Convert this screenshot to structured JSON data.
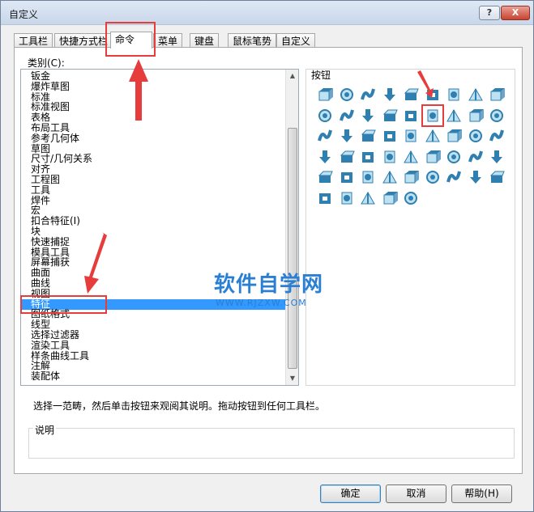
{
  "window": {
    "title": "自定义",
    "help_label": "?",
    "close_label": "X"
  },
  "tabs": [
    {
      "label": "工具栏"
    },
    {
      "label": "快捷方式栏"
    },
    {
      "label": "命令"
    },
    {
      "label": "菜单"
    },
    {
      "label": "键盘"
    },
    {
      "label": "鼠标笔势"
    },
    {
      "label": "自定义"
    }
  ],
  "categories": {
    "label": "类别(C):",
    "items": [
      "钣金",
      "爆炸草图",
      "标准",
      "标准视图",
      "表格",
      "布局工具",
      "参考几何体",
      "草图",
      "尺寸/几何关系",
      "对齐",
      "工程图",
      "工具",
      "焊件",
      "宏",
      "扣合特征(I)",
      "块",
      "快速捕捉",
      "模具工具",
      "屏幕捕获",
      "曲面",
      "曲线",
      "视图",
      "特征",
      "图纸格式",
      "线型",
      "选择过滤器",
      "渲染工具",
      "样条曲线工具",
      "注解",
      "装配体"
    ],
    "selected": "特征"
  },
  "buttons_group": {
    "label": "按钮",
    "icons": [
      "extruded-boss-icon",
      "revolved-boss-icon",
      "swept-boss-icon",
      "lofted-boss-icon",
      "boundary-boss-icon",
      "extruded-cut-icon",
      "revolved-cut-icon",
      "swept-cut-icon",
      "lofted-cut-icon",
      "boundary-cut-icon",
      "hole-wizard-icon",
      "fillet-icon",
      "chamfer-icon",
      "rib-icon",
      "shell-icon",
      "draft-icon",
      "wrap-icon",
      "dome-icon",
      "shape-icon",
      "flex-icon",
      "deform-icon",
      "indent-icon",
      "freeform-icon",
      "combine-icon",
      "intersect-icon",
      "split-icon",
      "move-face-icon",
      "delete-face-icon",
      "replace-face-icon",
      "thicken-icon",
      "cut-thicken-icon",
      "cut-surface-icon",
      "linear-pattern-icon",
      "circular-pattern-icon",
      "mirror-icon",
      "curve-pattern-icon",
      "sketch-pattern-icon",
      "table-pattern-icon",
      "fill-pattern-icon",
      "variable-pattern-icon",
      "scale-icon",
      "move-copy-icon",
      "suppress-icon",
      "unsuppress-icon",
      "rollback-icon",
      "instant3d-icon",
      "feature-works-icon",
      "library-feature-icon",
      "check-icon",
      "3d-texture-icon"
    ],
    "highlighted_index": 14
  },
  "description": "选择一范畴，然后单击按钮来观阅其说明。拖动按钮到任何工具栏。",
  "explain_label": "说明",
  "footer": {
    "ok_label": "确定",
    "cancel_label": "取消",
    "help_label": "帮助(H)"
  },
  "watermark": {
    "main": "软件自学网",
    "sub": "WWW.RJZXW.COM"
  },
  "colors": {
    "selection": "#3399ff",
    "annotation": "#e63c3c",
    "icon_primary": "#2f7fb0",
    "icon_light": "#bfe2f2"
  }
}
